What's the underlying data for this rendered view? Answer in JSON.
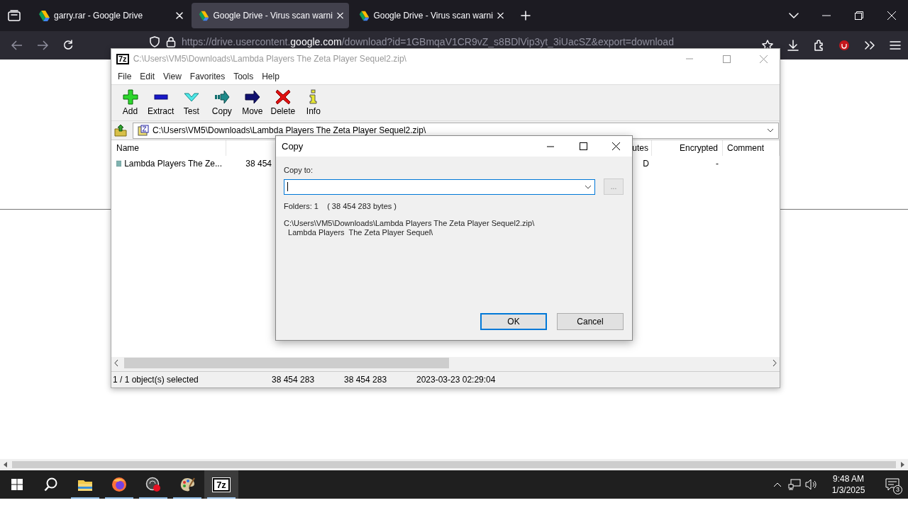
{
  "browser": {
    "tabs": [
      {
        "title": "garry.rar - Google Drive",
        "selected": false
      },
      {
        "title": "Google Drive - Virus scan warni",
        "selected": true
      },
      {
        "title": "Google Drive - Virus scan warni",
        "selected": false
      }
    ],
    "url": {
      "scheme": "https://drive.usercontent.",
      "domain": "google.com",
      "path": "/download?id=1GBmqaV1CR9vZ_s8BDlVip3yt_3iUacSZ&export=download"
    }
  },
  "archive_window": {
    "icon_label": "7z",
    "title": "C:\\Users\\VM5\\Downloads\\Lambda Players The Zeta Player Sequel2.zip\\",
    "active": false,
    "menu": [
      "File",
      "Edit",
      "View",
      "Favorites",
      "Tools",
      "Help"
    ],
    "toolbar": [
      {
        "label": "Add",
        "kind": "add"
      },
      {
        "label": "Extract",
        "kind": "extract"
      },
      {
        "label": "Test",
        "kind": "test"
      },
      {
        "label": "Copy",
        "kind": "copy"
      },
      {
        "label": "Move",
        "kind": "move"
      },
      {
        "label": "Delete",
        "kind": "delete"
      },
      {
        "label": "Info",
        "kind": "info"
      }
    ],
    "address": "C:\\Users\\VM5\\Downloads\\Lambda Players The Zeta Player Sequel2.zip\\",
    "table": {
      "columns": [
        "Name",
        "",
        "utes",
        "Encrypted",
        "Comment"
      ],
      "rows": [
        {
          "cells": [
            "Lambda Players  The Ze...",
            "38 454",
            "D",
            "-"
          ]
        }
      ]
    },
    "status_bar": [
      "1 / 1 object(s) selected",
      "38 454 283",
      "38 454 283",
      "2023-03-23 02:29:04"
    ]
  },
  "dialog": {
    "title": "Copy",
    "copy_to_label": "Copy to:",
    "browse_button": "...",
    "summary": "Folders: 1    ( 38 454 283 bytes )",
    "source_lines": [
      "C:\\Users\\VM5\\Downloads\\Lambda Players The Zeta Player Sequel2.zip\\",
      "  Lambda Players  The Zeta Player Sequel\\"
    ],
    "buttons": [
      {
        "label": "OK",
        "default": true
      },
      {
        "label": "Cancel",
        "default": false
      }
    ]
  },
  "taskbar": {
    "apps": [
      {
        "kind": "explorer",
        "running": true,
        "active": false
      },
      {
        "kind": "firefox",
        "running": true,
        "active": false
      },
      {
        "kind": "recorder",
        "running": true,
        "active": false
      },
      {
        "kind": "paint",
        "running": true,
        "active": false
      },
      {
        "kind": "sevenzip",
        "label": "7z",
        "running": true,
        "active": true
      }
    ],
    "time": "9:48 AM",
    "date": "1/3/2025",
    "notifications": "3"
  }
}
